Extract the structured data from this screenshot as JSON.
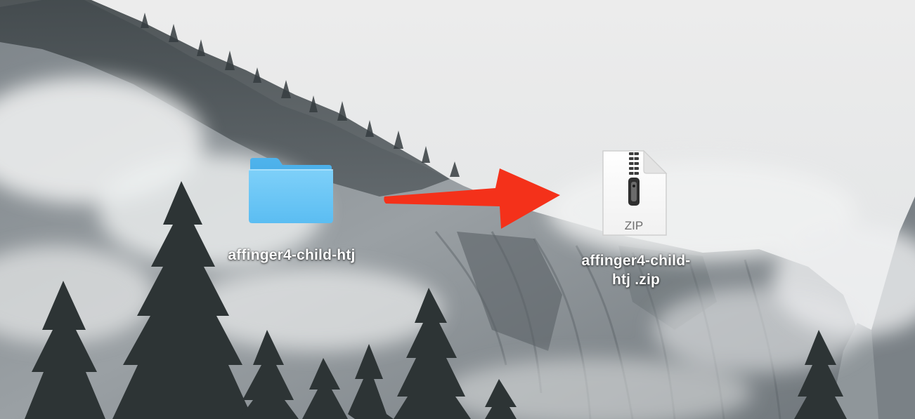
{
  "desktop": {
    "folder": {
      "name": "affinger4-child-htj",
      "icon": "folder-icon",
      "color": "#63c3f4"
    },
    "zip_file": {
      "name_line1": "affinger4-child-",
      "name_line2": "htj .zip",
      "icon": "zip-archive-icon",
      "badge": "ZIP"
    },
    "annotation": {
      "icon": "arrow-right-icon",
      "color": "#f4311a"
    }
  }
}
